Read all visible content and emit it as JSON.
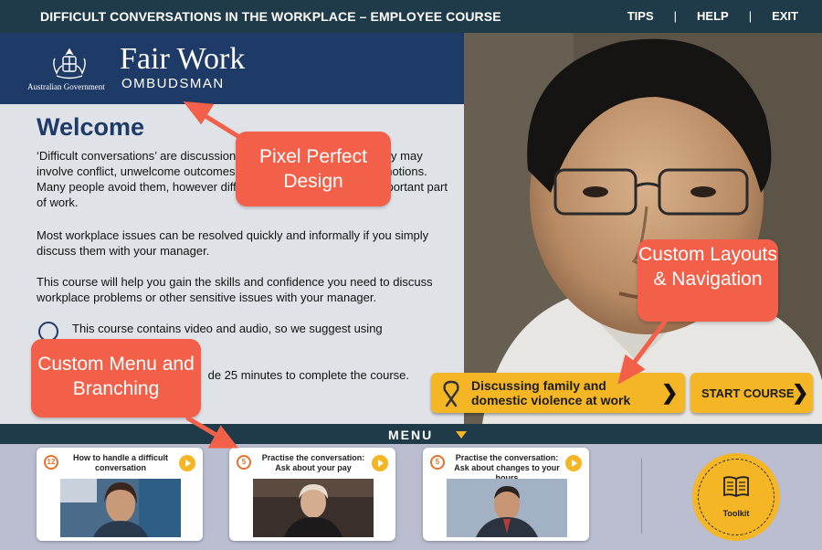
{
  "topbar": {
    "title": "DIFFICULT CONVERSATIONS IN THE WORKPLACE – EMPLOYEE COURSE",
    "links": [
      "TIPS",
      "HELP",
      "EXIT"
    ],
    "separator": "|"
  },
  "branding": {
    "gov_caption": "Australian Government",
    "name": "Fair Work",
    "sub": "OMBUDSMAN"
  },
  "content": {
    "heading": "Welcome",
    "paragraph1": "‘Difficult conversations’ are discussions that are uncomfortable - they may involve conflict, unwelcome outcomes, sensitive topics or strong emotions. Many people avoid them, however difficult conversations are an important part of work.",
    "paragraph2": "Most workplace issues can be resolved quickly and informally if you simply discuss them with your manager.",
    "paragraph3": "This course will help you gain the skills and confidence you need to discuss workplace problems or other sensitive issues with your manager.",
    "note1": "This course contains video and audio, so we suggest using",
    "note2": "de 25 minutes to complete the course."
  },
  "buttons": {
    "dv_label": "Discussing family and domestic violence at work",
    "start_label": "START COURSE",
    "chevron": "❯"
  },
  "menu": {
    "label": "MENU",
    "cards": [
      {
        "duration": "12",
        "title": "How to handle a difficult conversation"
      },
      {
        "duration": "5",
        "title": "Practise the conversation: Ask about your pay"
      },
      {
        "duration": "5",
        "title": "Practise the conversation: Ask about changes to your hours"
      }
    ],
    "toolkit_label": "Toolkit"
  },
  "annotations": {
    "pixel_perfect": "Pixel Perfect Design",
    "custom_layouts": "Custom Layouts & Navigation",
    "custom_menu": "Custom Menu and Branching"
  },
  "colors": {
    "topbar": "#1f3b4a",
    "brand_blue": "#1e3a66",
    "accent_yellow": "#f5b625",
    "callout_red": "#f2604a",
    "tray": "#b9bdcf"
  },
  "icons": [
    "ribbon-icon",
    "chevron-right-icon",
    "play-icon",
    "timer-icon",
    "book-icon",
    "caret-down-icon",
    "crest-icon",
    "info-icon"
  ]
}
